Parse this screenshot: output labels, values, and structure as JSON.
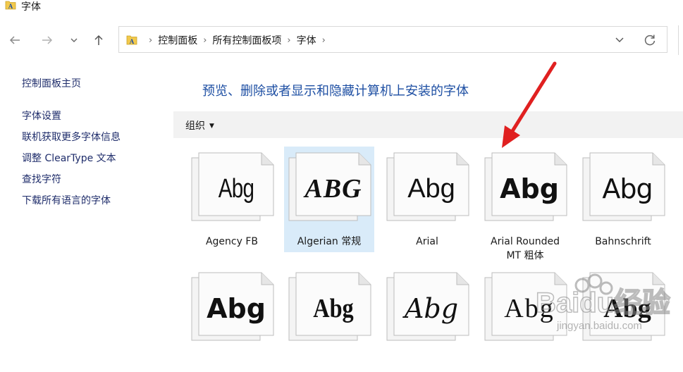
{
  "window": {
    "title": "字体"
  },
  "nav": {
    "back_icon": "back-arrow-icon",
    "forward_icon": "forward-arrow-icon",
    "recent_icon": "chevron-down-icon",
    "up_icon": "up-arrow-icon"
  },
  "address": {
    "crumbs": [
      "控制面板",
      "所有控制面板项",
      "字体"
    ]
  },
  "sidebar": {
    "items": [
      "控制面板主页",
      "字体设置",
      "联机获取更多字体信息",
      "调整 ClearType 文本",
      "查找字符",
      "下载所有语言的字体"
    ]
  },
  "main": {
    "heading": "预览、删除或者显示和隐藏计算机上安装的字体",
    "organize_label": "组织"
  },
  "fonts": [
    {
      "sample": "Abg",
      "label": "Agency FB",
      "selected": false
    },
    {
      "sample": "ABG",
      "label": "Algerian 常规",
      "selected": true
    },
    {
      "sample": "Abg",
      "label": "Arial",
      "selected": false
    },
    {
      "sample": "Abg",
      "label": "Arial Rounded MT 粗体",
      "selected": false
    },
    {
      "sample": "Abg",
      "label": "Bahnschrift",
      "selected": false
    },
    {
      "sample": "Abg",
      "label": "",
      "selected": false
    },
    {
      "sample": "Abg",
      "label": "",
      "selected": false
    },
    {
      "sample": "Abg",
      "label": "",
      "selected": false
    },
    {
      "sample": "Abg",
      "label": "",
      "selected": false
    },
    {
      "sample": "Abg",
      "label": "",
      "selected": false
    }
  ],
  "watermark": {
    "brand": "Baidu经验",
    "url": "jingyan.baidu.com"
  },
  "colors": {
    "heading": "#1e4fa3",
    "link": "#1f2d6b",
    "selection": "#d9ebf9",
    "annotation_arrow": "#e02020"
  }
}
